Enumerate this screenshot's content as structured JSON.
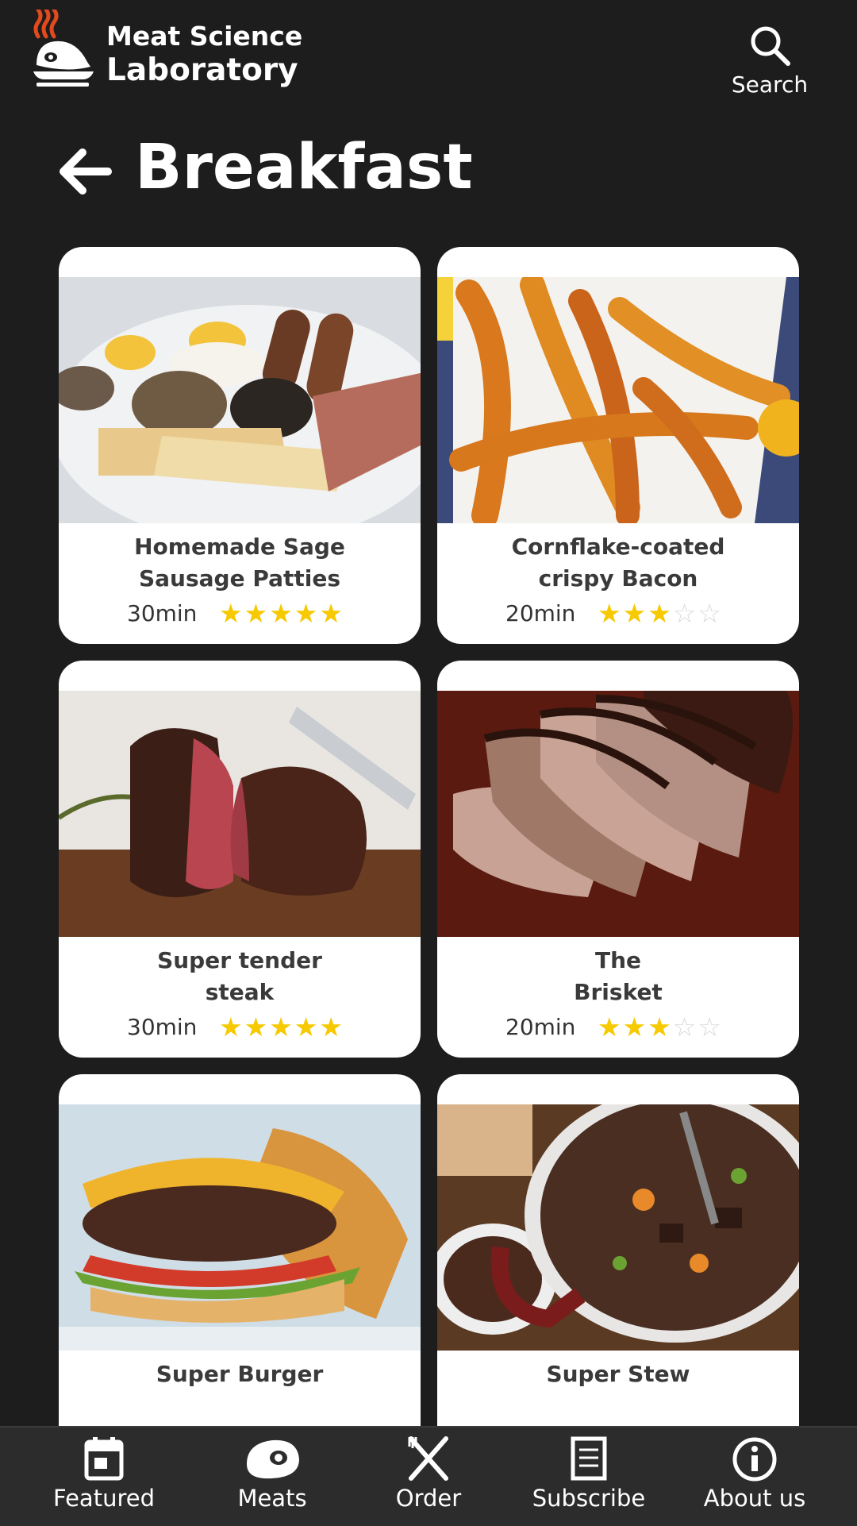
{
  "app": {
    "brand_line1": "Meat Science",
    "brand_line2": "Laboratory",
    "search_label": "Search"
  },
  "page": {
    "title": "Breakfast"
  },
  "icons": {
    "logo": "meat-logo-icon",
    "search": "search-icon",
    "back": "back-arrow-icon",
    "star": "star-icon"
  },
  "colors": {
    "background": "#1d1d1e",
    "card": "#ffffff",
    "star": "#f6c900",
    "nav": "#2c2c2d"
  },
  "recipes": [
    {
      "name_line1": "Homemade Sage",
      "name_line2": "Sausage Patties",
      "time": "30min",
      "rating": 5,
      "max_rating": 5
    },
    {
      "name_line1": "Cornflake-coated",
      "name_line2": "crispy Bacon",
      "time": "20min",
      "rating": 3,
      "max_rating": 5
    },
    {
      "name_line1": "Super tender",
      "name_line2": "steak",
      "time": "30min",
      "rating": 5,
      "max_rating": 5
    },
    {
      "name_line1": "The",
      "name_line2": "Brisket",
      "time": "20min",
      "rating": 3,
      "max_rating": 5
    },
    {
      "name_line1": "Super Burger",
      "name_line2": ""
    },
    {
      "name_line1": "Super Stew",
      "name_line2": ""
    }
  ],
  "nav": [
    {
      "label": "Featured",
      "icon": "calendar-icon"
    },
    {
      "label": "Meats",
      "icon": "meat-icon"
    },
    {
      "label": "Order",
      "icon": "utensils-icon"
    },
    {
      "label": "Subscribe",
      "icon": "document-icon"
    },
    {
      "label": "About us",
      "icon": "info-icon"
    }
  ]
}
